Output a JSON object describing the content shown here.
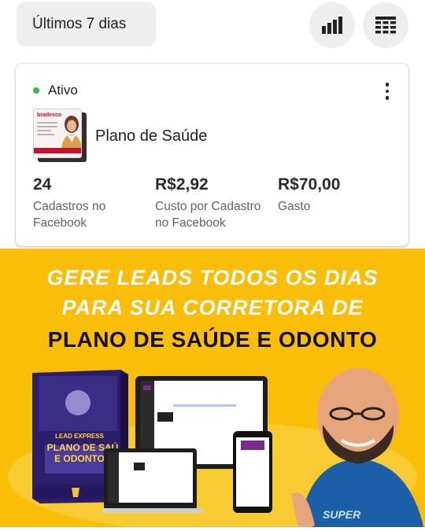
{
  "toolbar": {
    "date_range": "Últimos 7 dias",
    "chart_view_icon": "bar-chart-icon",
    "table_view_icon": "table-icon"
  },
  "card": {
    "status": "Ativo",
    "status_color": "#3fb33f",
    "menu_icon": "more-vertical-icon",
    "thumbnail_logo": "bradesco",
    "ad_name": "Plano de Saúde",
    "metrics": [
      {
        "value": "24",
        "label": "Cadastros no Facebook"
      },
      {
        "value": "R$2,92",
        "label": "Custo por Cadastro no Facebook"
      },
      {
        "value": "R$70,00",
        "label": "Gasto"
      }
    ]
  },
  "banner": {
    "background": "#fbbe08",
    "headline_1": "GERE LEADS TODOS OS DIAS",
    "headline_2": "PARA  SUA CORRETORA DE",
    "headline_3": "PLANO DE SAÚDE E ODONTO",
    "box_brand": "LEAD EXPRESS",
    "box_title_1": "PLANO DE SAÚ",
    "box_title_2": "E ODONTO",
    "shirt_text": "SUPER"
  }
}
